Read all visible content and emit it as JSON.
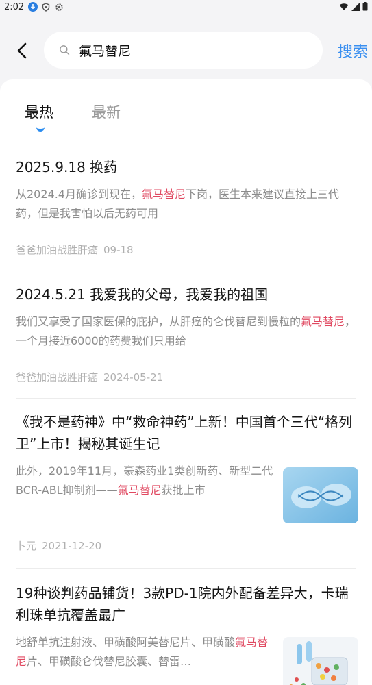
{
  "status": {
    "time": "2:02"
  },
  "search": {
    "query": "氟马替尼",
    "button": "搜索"
  },
  "tabs": [
    {
      "label": "最热",
      "active": true
    },
    {
      "label": "最新",
      "active": false
    }
  ],
  "accent_color": "#3a8ff0",
  "highlight_color": "#e04860",
  "articles": [
    {
      "title": "2025.9.18 换药",
      "snippet_before": "从2024.4月确诊到现在，",
      "snippet_hl": "氟马替尼",
      "snippet_after": "下岗，医生本来建议直接上三代药，但是我害怕以后无药可用",
      "author": "爸爸加油战胜肝癌",
      "date": "09-18"
    },
    {
      "title": "2024.5.21 我爱我的父母，我爱我的祖国",
      "snippet_before": "我们又享受了国家医保的庇护，从肝癌的仑伐替尼到慢粒的",
      "snippet_hl": "氟马替尼",
      "snippet_after": "，一个月接近6000的药费我们只用给",
      "author": "爸爸加油战胜肝癌",
      "date": "2024-05-21"
    },
    {
      "title": "《我不是药神》中“救命神药”上新！中国首个三代“格列卫”上市！揭秘其诞生记",
      "snippet_before": "此外，2019年11月，豪森药业1类创新药、新型二代BCR-ABL抑制剂——",
      "snippet_hl": "氟马替尼",
      "snippet_after": "获批上市",
      "author": "卜元",
      "date": "2021-12-20",
      "thumb_icon": "dna-capsule-image"
    },
    {
      "title": "19种谈判药品铺货！3款PD-1院内外配备差异大，卡瑞利珠单抗覆盖最广",
      "snippet_before": "地舒单抗注射液、甲磺酸阿美替尼片、甲磺酸",
      "snippet_hl": "氟马替尼",
      "snippet_after": "片、甲磺酸仑伐替尼胶囊、替雷…",
      "thumb_icon": "pills-box-image"
    }
  ]
}
